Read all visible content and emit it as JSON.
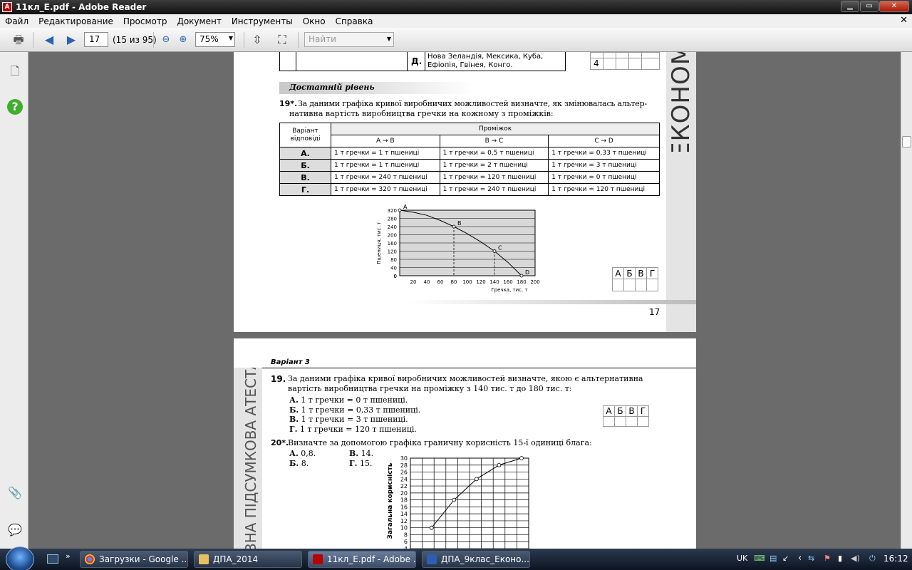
{
  "window": {
    "title": "11кл_Е.pdf - Adobe Reader"
  },
  "menu": [
    "Файл",
    "Редактирование",
    "Просмотр",
    "Документ",
    "Инструменты",
    "Окно",
    "Справка"
  ],
  "toolbar": {
    "page": "17",
    "page_count": "(15 из 95)",
    "zoom": "75%",
    "find_placeholder": "Найти"
  },
  "page1": {
    "top_row": {
      "letter": "Д.",
      "text_line1": "Нова Зеландія, Мексика, Куба,",
      "text_line2": "Ефіопія, Гвінея, Конго."
    },
    "top_answer_num": "4",
    "side_text": "ЕКОНОМ",
    "section": "Достатній рівень",
    "q_num": "19*.",
    "q_line1": "За даними графіка кривої виробничих можливостей визначте, як змінювалась альтер-",
    "q_line2": "нативна вартість виробництва гречки на кожному з проміжків:",
    "table": {
      "h_variant": "Варіант",
      "h_variant2": "відповіді",
      "h_interval": "Проміжок",
      "cols": [
        "A → B",
        "B → C",
        "C → D"
      ],
      "rows": [
        {
          "v": "А.",
          "c": [
            "1 т гречки = 1 т пшениці",
            "1 т гречки = 0,5 т пшениці",
            "1 т гречки = 0,33 т пшениці"
          ]
        },
        {
          "v": "Б.",
          "c": [
            "1 т гречки = 1 т пшениці",
            "1 т гречки = 2 т пшениці",
            "1 т гречки = 3 т пшениці"
          ]
        },
        {
          "v": "В.",
          "c": [
            "1 т гречки = 240 т пшениці",
            "1 т гречки = 120 т пшениці",
            "1 т гречки = 0 т пшениці"
          ]
        },
        {
          "v": "Г.",
          "c": [
            "1 т гречки = 320 т пшениці",
            "1 т гречки = 240 т пшениці",
            "1 т гречки = 120 т пшениці"
          ]
        }
      ]
    },
    "answer_letters": [
      "А",
      "Б",
      "В",
      "Г"
    ],
    "page_number": "17"
  },
  "chart1": {
    "ylabel": "Пшениця, тис. т",
    "xlabel": "Гречка, тис. т",
    "yticks": [
      "320",
      "280",
      "240",
      "200",
      "160",
      "120",
      "80",
      "40",
      "0"
    ],
    "xticks": [
      "20",
      "40",
      "60",
      "80",
      "100",
      "120",
      "140",
      "160",
      "180",
      "200"
    ],
    "point_labels": [
      "A",
      "B",
      "C",
      "D"
    ]
  },
  "page2": {
    "variant": "Варіант 3",
    "side_text": "ВНА ПІДСУМКОВА АТЕСТАЦІЯ",
    "q19_num": "19.",
    "q19_line1": "За даними графіка кривої виробничих можливостей визначте, якою є альтернативна",
    "q19_line2": "вартість виробництва гречки на проміжку з 140 тис. т до 180 тис. т:",
    "q19_options": [
      {
        "l": "А.",
        "t": "1 т гречки = 0 т пшениці."
      },
      {
        "l": "Б.",
        "t": "1 т гречки = 0,33 т пшениці."
      },
      {
        "l": "В.",
        "t": "1 т гречки = 3 т пшениці."
      },
      {
        "l": "Г.",
        "t": "1 т гречки = 120 т пшениці."
      }
    ],
    "answer_letters": [
      "А",
      "Б",
      "В",
      "Г"
    ],
    "q20_num": "20*.",
    "q20_text": "Визначте за допомогою графіка граничну корисність 15-ї одиниці блага:",
    "q20_options": [
      {
        "l": "А.",
        "t": "0,8."
      },
      {
        "l": "В.",
        "t": "14."
      },
      {
        "l": "Б.",
        "t": "8."
      },
      {
        "l": "Г.",
        "t": "15."
      }
    ]
  },
  "chart2": {
    "ylabel": "Загальна корисність",
    "yticks": [
      "30",
      "28",
      "26",
      "24",
      "22",
      "20",
      "18",
      "16",
      "14",
      "12",
      "10",
      "8",
      "6",
      "4"
    ]
  },
  "chart_data": [
    {
      "type": "line",
      "title": "",
      "xlabel": "Гречка, тис. т",
      "ylabel": "Пшениця, тис. т",
      "xlim": [
        0,
        200
      ],
      "ylim": [
        0,
        320
      ],
      "grid": true,
      "series": [
        {
          "name": "",
          "x": [
            0,
            80,
            140,
            180
          ],
          "y": [
            320,
            240,
            120,
            0
          ]
        }
      ],
      "labels": [
        "A",
        "B",
        "C",
        "D"
      ],
      "curve": {
        "x": [
          0,
          20,
          40,
          60,
          80,
          100,
          120,
          140,
          160,
          180
        ],
        "y": [
          320,
          310,
          295,
          270,
          240,
          205,
          165,
          120,
          65,
          0
        ]
      }
    },
    {
      "type": "line",
      "title": "",
      "xlabel": "",
      "ylabel": "Загальна корисність",
      "ylim": [
        4,
        30
      ],
      "grid": true,
      "series": [
        {
          "name": "",
          "x": [
            1,
            2,
            3,
            4,
            5
          ],
          "y": [
            10,
            18,
            24,
            28,
            30
          ]
        }
      ]
    }
  ],
  "taskbar": {
    "items": [
      "Загрузки - Google ...",
      "ДПА_2014",
      "11кл_Е.pdf - Adobe ...",
      "ДПА_9клас_Еконо..."
    ],
    "lang": "UK",
    "time": "16:12"
  }
}
